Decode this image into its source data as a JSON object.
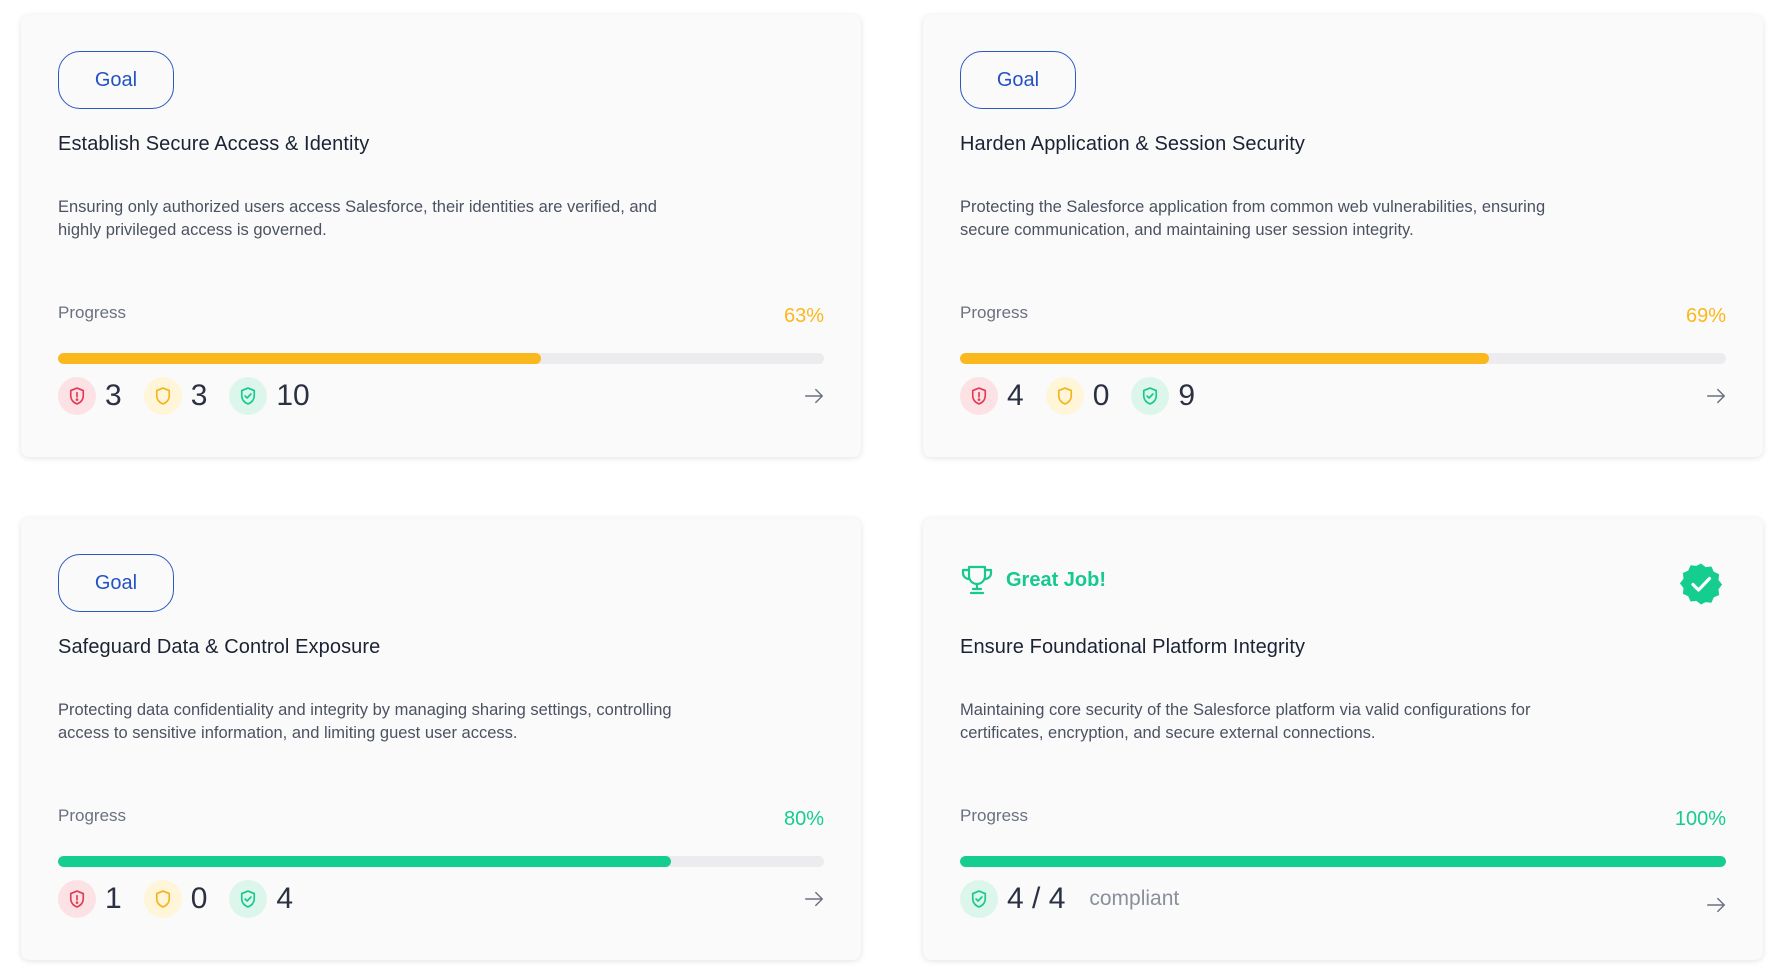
{
  "colors": {
    "goal_blue": "#2452c4",
    "warning_yellow": "#fbb81c",
    "success_green": "#15cd8f",
    "critical_red": "#e33b54",
    "track_gray": "#ececef"
  },
  "cards": [
    {
      "type": "goal",
      "badge": "Goal",
      "title": "Establish Secure Access & Identity",
      "description": "Ensuring only authorized users access Salesforce, their identities are verified, and highly privileged access is governed.",
      "progress_label": "Progress",
      "progress_text": "63%",
      "progress_value": 0.63,
      "progress_color": "#fbb81c",
      "stats": {
        "critical": "3",
        "warning": "3",
        "passed": "10"
      }
    },
    {
      "type": "goal",
      "badge": "Goal",
      "title": "Harden Application & Session Security",
      "description": "Protecting the Salesforce application from common web vulnerabilities, ensuring secure communication, and maintaining user session integrity.",
      "progress_label": "Progress",
      "progress_text": "69%",
      "progress_value": 0.69,
      "progress_color": "#fbb81c",
      "stats": {
        "critical": "4",
        "warning": "0",
        "passed": "9"
      }
    },
    {
      "type": "goal",
      "badge": "Goal",
      "title": "Safeguard Data & Control Exposure",
      "description": "Protecting data confidentiality and integrity by managing sharing settings, controlling access to sensitive information, and limiting guest user access.",
      "progress_label": "Progress",
      "progress_text": "80%",
      "progress_value": 0.8,
      "progress_color": "#15cd8f",
      "stats": {
        "critical": "1",
        "warning": "0",
        "passed": "4"
      }
    },
    {
      "type": "complete",
      "badge": "Great Job!",
      "title": "Ensure Foundational Platform Integrity",
      "description": "Maintaining core security of the Salesforce platform via valid configurations for certificates, encryption, and secure external connections.",
      "progress_label": "Progress",
      "progress_text": "100%",
      "progress_value": 1.0,
      "progress_color": "#15cd8f",
      "compliant_count": "4 / 4",
      "compliant_label": "compliant"
    }
  ],
  "icons": {
    "critical": "shield-alert-icon",
    "warning": "shield-icon",
    "passed": "shield-check-icon",
    "trophy": "trophy-icon",
    "verified": "verified-badge-icon",
    "arrow": "arrow-right-icon"
  }
}
